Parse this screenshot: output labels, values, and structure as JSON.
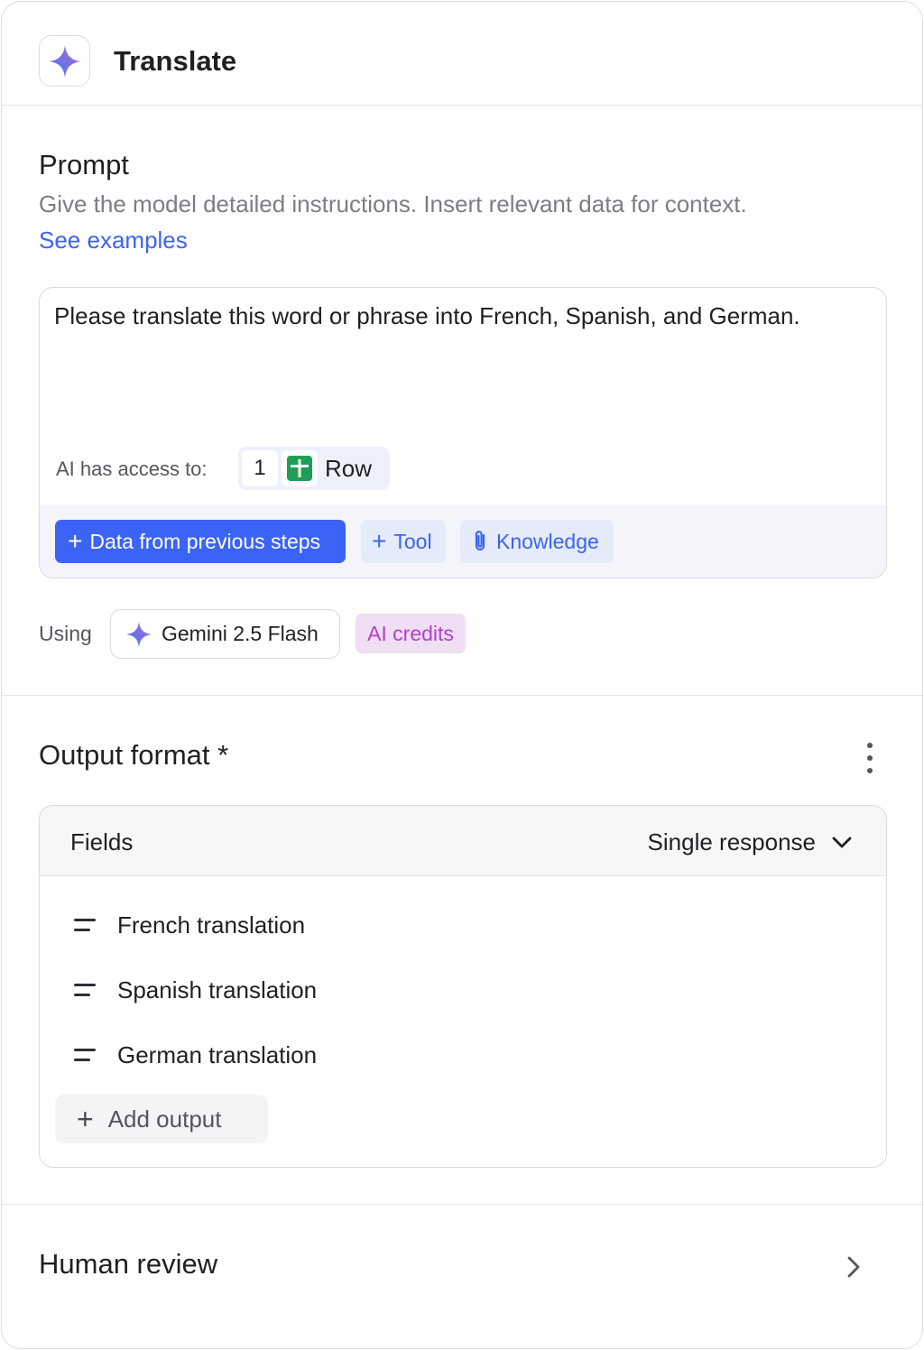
{
  "header": {
    "title": "Translate",
    "icon": "gemini-sparkle-icon"
  },
  "prompt": {
    "title": "Prompt",
    "description": "Give the model detailed instructions. Insert relevant data for context.",
    "link": "See examples",
    "text": "Please translate this word or phrase into French, Spanish, and German.",
    "access_label": "AI has access to:",
    "access_count": "1",
    "access_item": "Row",
    "buttons": {
      "data_steps": "Data from previous steps",
      "tool": "Tool",
      "knowledge": "Knowledge"
    }
  },
  "model": {
    "using_label": "Using",
    "name": "Gemini 2.5 Flash",
    "badge": "AI credits"
  },
  "output": {
    "title": "Output format *",
    "fields_label": "Fields",
    "mode": "Single response",
    "fields": [
      {
        "label": "French translation"
      },
      {
        "label": "Spanish translation"
      },
      {
        "label": "German translation"
      }
    ],
    "add_label": "Add output"
  },
  "review": {
    "title": "Human review"
  },
  "colors": {
    "accent": "#3b63f5",
    "accent_soft": "#e6ebfb",
    "credits_bg": "#f0def4",
    "credits_text": "#b43ed0",
    "sheet_green": "#1e9e57"
  }
}
